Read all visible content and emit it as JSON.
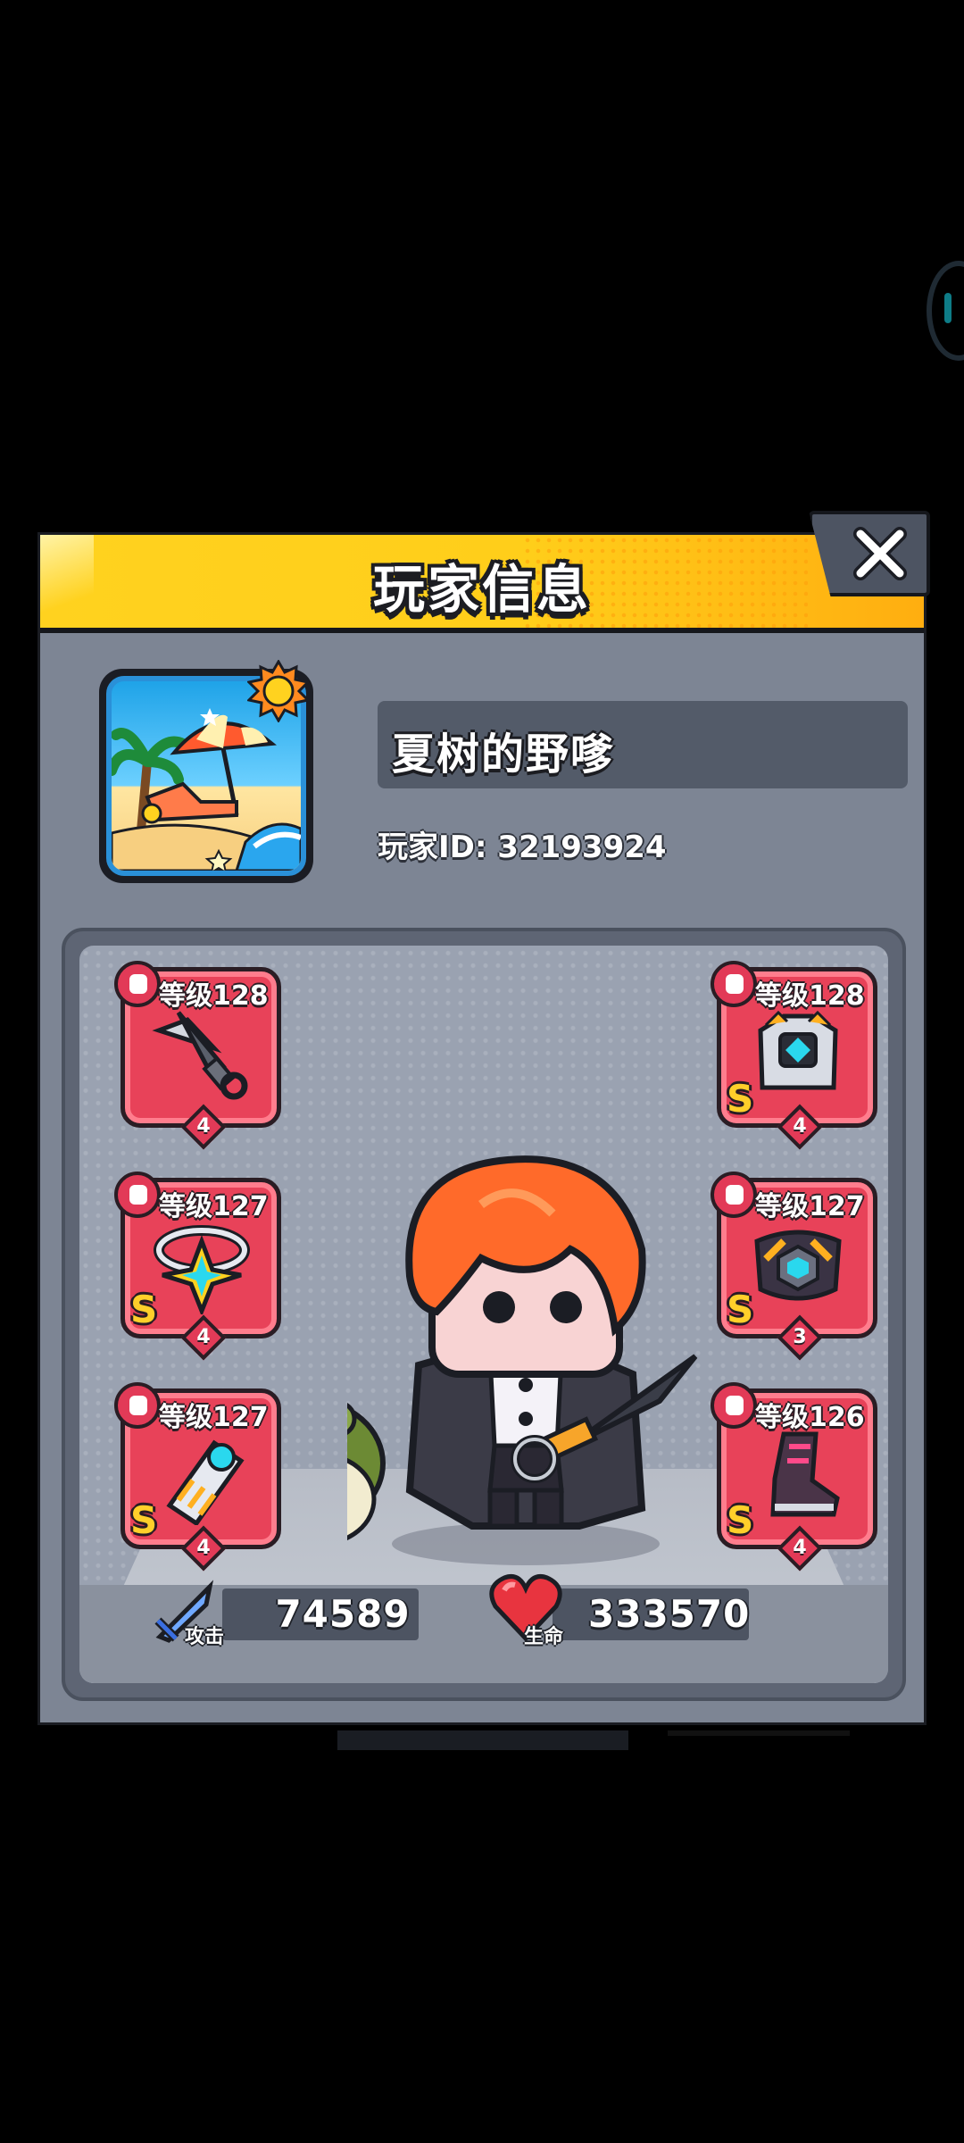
{
  "dialog": {
    "title": "玩家信息",
    "close_icon": "close-icon"
  },
  "player": {
    "name": "夏树的野嗲",
    "id_text": "玩家ID: 32193924",
    "avatar_icon": "beach-umbrella-avatar",
    "frame_badge_icon": "sun-icon"
  },
  "equipment": [
    {
      "slot": "weapon",
      "icon": "kunai-icon",
      "level_text": "等级128",
      "grade": "",
      "stars": "4"
    },
    {
      "slot": "necklace",
      "icon": "necklace-icon",
      "level_text": "等级127",
      "grade": "S",
      "stars": "4"
    },
    {
      "slot": "gloves",
      "icon": "gauntlet-icon",
      "level_text": "等级127",
      "grade": "S",
      "stars": "4"
    },
    {
      "slot": "armor",
      "icon": "armor-icon",
      "level_text": "等级128",
      "grade": "S",
      "stars": "4"
    },
    {
      "slot": "belt",
      "icon": "belt-icon",
      "level_text": "等级127",
      "grade": "S",
      "stars": "3"
    },
    {
      "slot": "boots",
      "icon": "boots-icon",
      "level_text": "等级126",
      "grade": "S",
      "stars": "4"
    }
  ],
  "stats": {
    "attack": {
      "label": "攻击",
      "value": "74589",
      "icon": "sword-icon"
    },
    "hp": {
      "label": "生命",
      "value": "333570",
      "icon": "heart-icon"
    }
  },
  "colors": {
    "header": "#ffd21f",
    "panel": "#7d8594",
    "slot": "#e84259",
    "grade": "#ffcf2a"
  }
}
